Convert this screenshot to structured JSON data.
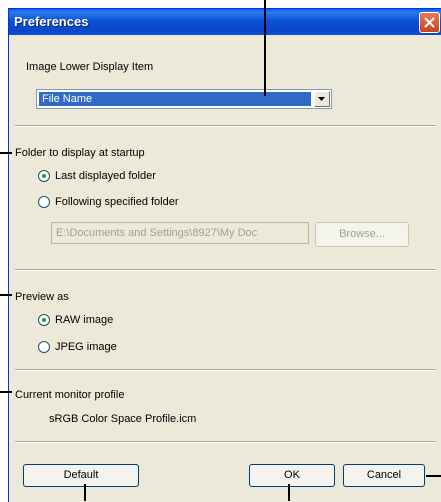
{
  "window": {
    "title": "Preferences",
    "close_icon": "close-icon"
  },
  "image_lower": {
    "label": "Image Lower Display Item",
    "selected": "File Name"
  },
  "startup_folder": {
    "label": "Folder to display at startup",
    "options": [
      {
        "label": "Last displayed folder",
        "checked": true
      },
      {
        "label": "Following specified folder",
        "checked": false
      }
    ],
    "path_value": "E:\\Documents and Settings\\8927\\My Doc",
    "browse_label": "Browse..."
  },
  "preview": {
    "label": "Preview as",
    "options": [
      {
        "label": "RAW image",
        "checked": true
      },
      {
        "label": "JPEG image",
        "checked": false
      }
    ]
  },
  "monitor": {
    "label": "Current monitor profile",
    "value": "sRGB Color Space Profile.icm"
  },
  "buttons": {
    "default": "Default",
    "ok": "OK",
    "cancel": "Cancel"
  },
  "colors": {
    "titlebar": "#0a52d8",
    "dialog_bg": "#ece9d8",
    "selection": "#316ac5"
  }
}
